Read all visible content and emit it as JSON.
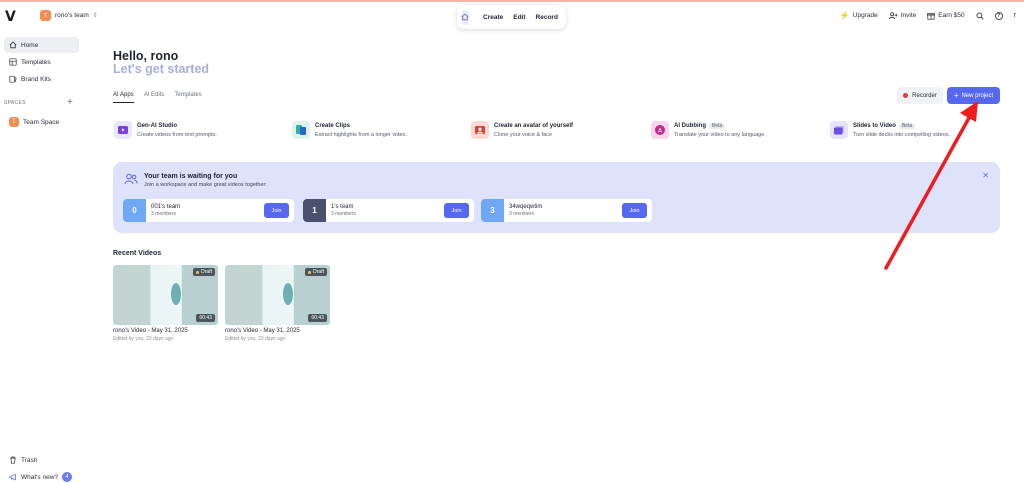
{
  "topbar": {
    "logo": "V",
    "team_initial": "r",
    "team_name": "rono's team",
    "nav": [
      "Create",
      "Edit",
      "Record"
    ],
    "upgrade": "Upgrade",
    "invite": "Invite",
    "earn": "Earn $50",
    "user_initial": "r"
  },
  "sidebar": {
    "home": "Home",
    "templates": "Templates",
    "brand_kits": "Brand Kits",
    "spaces_label": "SPACES",
    "team_space_initial": "T",
    "team_space": "Team Space",
    "trash": "Trash",
    "whats_new": "What's new?",
    "whats_new_count": "4"
  },
  "main": {
    "greeting": "Hello, rono",
    "subgreeting": "Let's get started",
    "tabs": [
      "AI Apps",
      "AI Edits",
      "Templates"
    ],
    "recorder": "Recorder",
    "new_project": "New project",
    "apps": [
      {
        "title": "Gen-AI Studio",
        "desc": "Create videos from text prompts.",
        "beta": ""
      },
      {
        "title": "Create Clips",
        "desc": "Extract highlights from a longer video.",
        "beta": ""
      },
      {
        "title": "Create an avatar of yourself",
        "desc": "Clone your voice & face",
        "beta": ""
      },
      {
        "title": "AI Dubbing",
        "desc": "Translate your video to any language.",
        "beta": "Beta"
      },
      {
        "title": "Slides to Video",
        "desc": "Turn slide decks into compelling videos.",
        "beta": "Beta"
      }
    ],
    "banner": {
      "title": "Your team is waiting for you",
      "subtitle": "Join a workspace and make great videos together:",
      "join_label": "Join",
      "teams": [
        {
          "initial": "0",
          "name": "001's team",
          "members": "3 members",
          "color": "#6fa8f5"
        },
        {
          "initial": "1",
          "name": "1's team",
          "members": "3 members",
          "color": "#4a5170"
        },
        {
          "initial": "3",
          "name": "34wqeqwtim",
          "members": "3 members",
          "color": "#6fa8f5"
        }
      ]
    },
    "recent_title": "Recent Videos",
    "videos": [
      {
        "title": "rono's Video - May 31, 2025",
        "meta": "Edited by you, 23 days ago",
        "status": "Draft",
        "duration": "00:43"
      },
      {
        "title": "rono's Video - May 31, 2025",
        "meta": "Edited by you, 23 days ago",
        "status": "Draft",
        "duration": "00:43"
      }
    ]
  },
  "colors": {
    "accent": "#5667f0",
    "banner_bg": "#dfe2fb",
    "annotation_arrow": "#ee1c1c"
  }
}
